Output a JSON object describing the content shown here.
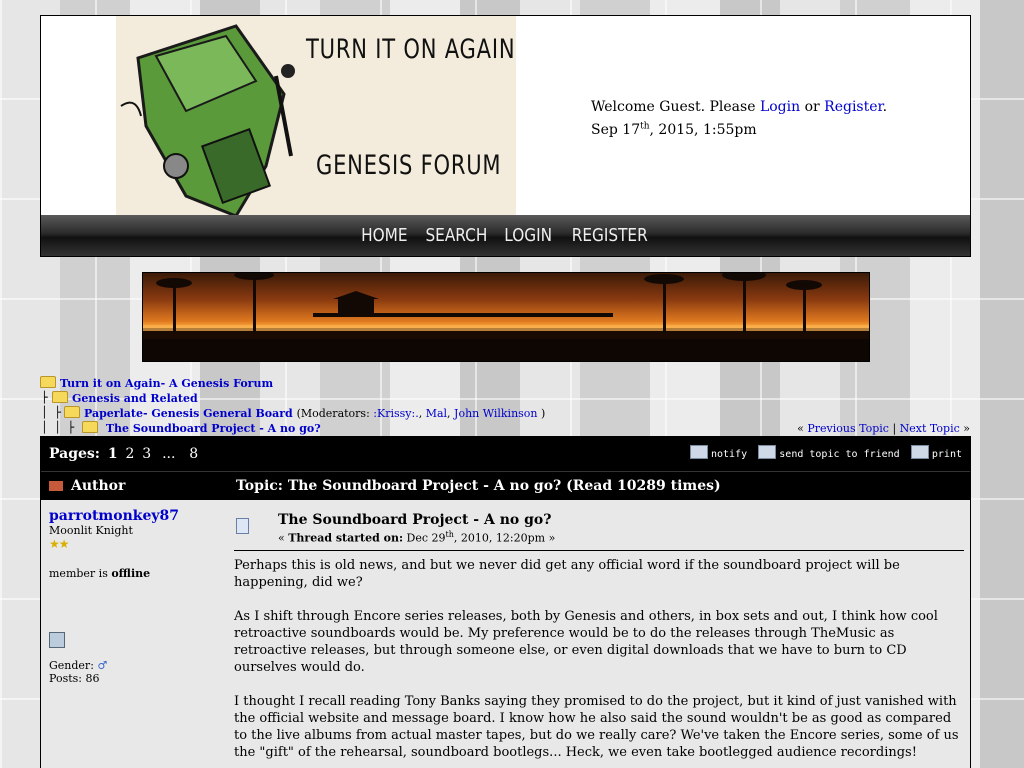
{
  "header": {
    "logo_title": "TURN IT ON AGAIN",
    "logo_subtitle": "GENESIS FORUM",
    "welcome_prefix": "Welcome Guest. Please ",
    "login_link": "Login",
    "or": " or ",
    "register_link": "Register",
    "period": ".",
    "date_prefix": "Sep 17",
    "date_sup": "th",
    "date_suffix": ", 2015, 1:55pm"
  },
  "nav": {
    "items": [
      "HOME",
      "SEARCH",
      "LOGIN",
      "REGISTER"
    ]
  },
  "breadcrumb": {
    "forum": "Turn it on Again- A Genesis Forum",
    "category": "Genesis and Related",
    "board": "Paperlate- Genesis General Board",
    "moderators_label": "(Moderators: ",
    "moderators": [
      ":Krissy:.",
      "Mal",
      "John Wilkinson"
    ],
    "moderators_close": " )",
    "topic": "The Soundboard Project - A no go?"
  },
  "topic_nav": {
    "prev_mark": "« ",
    "previous": "Previous Topic",
    "sep": " | ",
    "next": "Next Topic",
    "next_mark": " »"
  },
  "pages": {
    "label": "Pages:",
    "current": "1",
    "others": [
      "2",
      "3"
    ],
    "ellipsis": "...",
    "last": "8"
  },
  "actions": [
    "notify",
    "send topic to friend",
    "print"
  ],
  "table_head": {
    "author": "Author",
    "topic": "Topic: The Soundboard Project - A no go?  (Read 10289 times)"
  },
  "post": {
    "author": "parrotmonkey87",
    "rank": "Moonlit Knight",
    "stars": "★★",
    "status_prefix": "member is ",
    "status": "offline",
    "gender_label": "Gender: ",
    "gender_icon": "♂",
    "posts": "Posts: 86",
    "title": "The Soundboard Project - A no go?",
    "started_prefix": "« ",
    "started_label": "Thread started on:",
    "date_a": " Dec 29",
    "date_sup": "th",
    "date_b": ", 2010, 12:20pm »",
    "body": [
      "Perhaps this is old news, and but we never did get any official word if the soundboard project will be happening, did we?",
      "As I shift through Encore series releases, both by Genesis and others, in box sets and out, I think how cool retroactive soundboards would be. My preference would be to do the releases through TheMusic as retroactive releases, but through someone else, or even digital downloads that we have to burn to CD ourselves would do.",
      "I thought I recall reading Tony Banks saying they promised to do the project, but it kind of just vanished with the official website and message board. I know how he also said the sound wouldn't be as good as compared to the live albums from actual master tapes, but do we really care? We've taken the Encore series, some of us the \"gift\" of the rehearsal, soundboard bootlegs... Heck, we even take bootlegged audience recordings!"
    ]
  }
}
